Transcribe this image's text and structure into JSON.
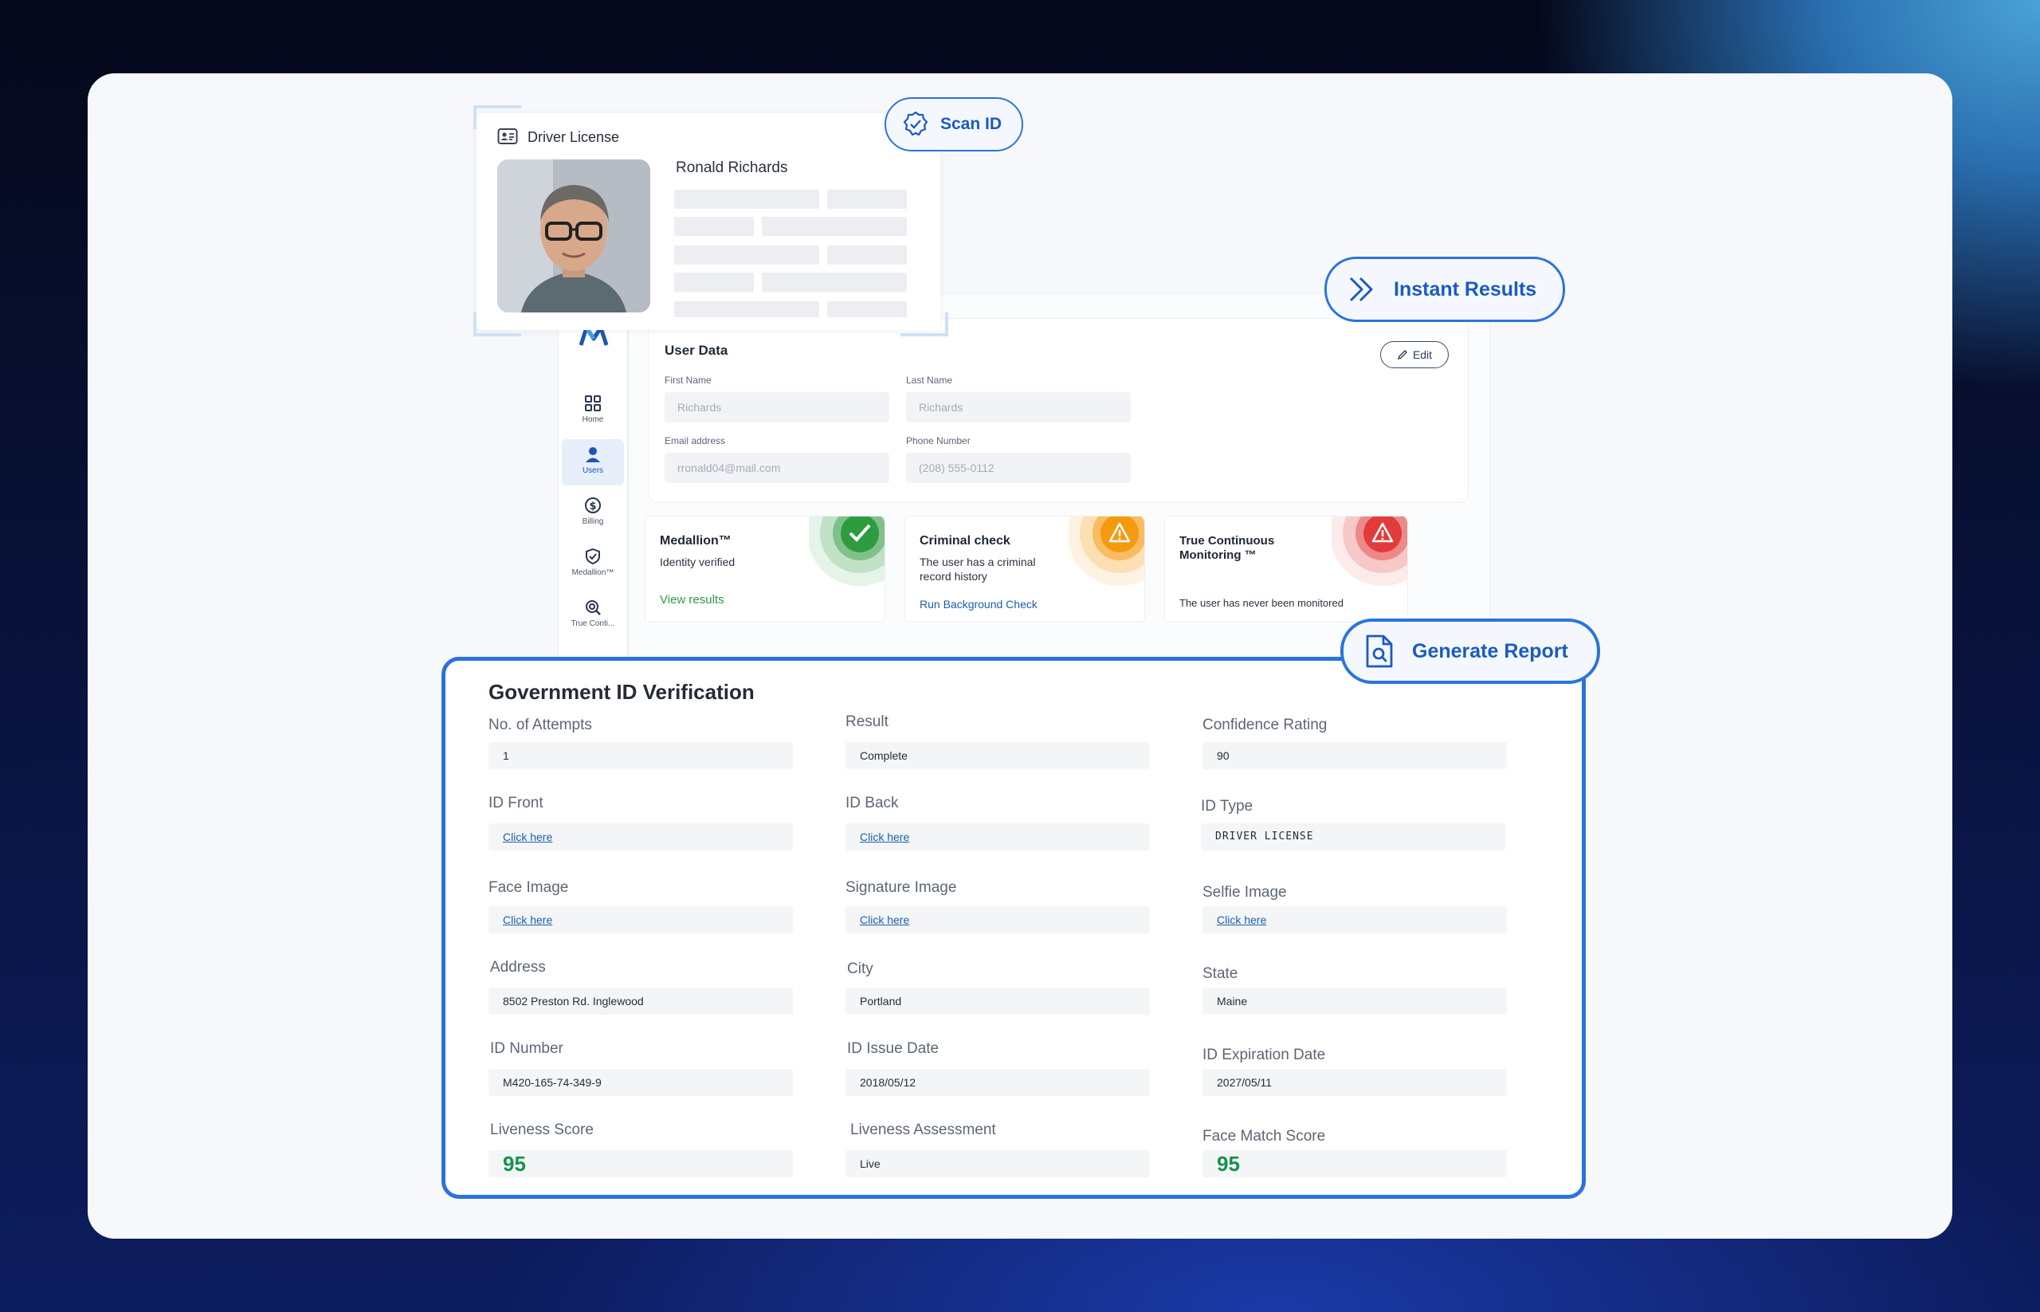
{
  "driver_license": {
    "title": "Driver License",
    "name": "Ronald Richards"
  },
  "pills": {
    "scan_id": "Scan ID",
    "instant_results": "Instant Results",
    "generate_report": "Generate Report"
  },
  "sidebar": {
    "items": [
      {
        "label": "Home",
        "icon": "grid-icon"
      },
      {
        "label": "Users",
        "icon": "user-icon"
      },
      {
        "label": "Billing",
        "icon": "dollar-icon"
      },
      {
        "label": "Medallion™",
        "icon": "shield-check-icon"
      },
      {
        "label": "True Conti...",
        "icon": "search-icon"
      }
    ]
  },
  "user_data": {
    "title": "User Data",
    "edit_label": "Edit",
    "first_name_label": "First Name",
    "first_name_value": "Richards",
    "last_name_label": "Last Name",
    "last_name_value": "Richards",
    "email_label": "Email address",
    "email_value": "rronald04@mail.com",
    "phone_label": "Phone Number",
    "phone_value": "(208) 555-0112"
  },
  "status_cards": {
    "medallion": {
      "title": "Medallion™",
      "desc": "Identity verified",
      "link": "View results",
      "color": "#2e9b3f"
    },
    "criminal": {
      "title": "Criminal check",
      "desc": "The user has a criminal record history",
      "link": "Run Background Check",
      "color": "#f59a0f"
    },
    "monitoring": {
      "title": "True Continuous Monitoring ™",
      "desc": "The user has never been monitored",
      "color": "#e23b3b"
    }
  },
  "verification": {
    "title": "Government ID Verification",
    "fields": {
      "attempts": {
        "label": "No. of Attempts",
        "value": "1"
      },
      "result": {
        "label": "Result",
        "value": "Complete"
      },
      "confidence": {
        "label": "Confidence Rating",
        "value": "90"
      },
      "id_front": {
        "label": "ID Front",
        "value": "Click here"
      },
      "id_back": {
        "label": "ID Back",
        "value": "Click here"
      },
      "id_type": {
        "label": "ID Type",
        "value": "DRIVER LICENSE"
      },
      "face_image": {
        "label": "Face Image",
        "value": "Click here"
      },
      "signature_image": {
        "label": "Signature Image",
        "value": "Click here"
      },
      "selfie_image": {
        "label": "Selfie Image",
        "value": "Click here"
      },
      "address": {
        "label": "Address",
        "value": "8502 Preston Rd. Inglewood"
      },
      "city": {
        "label": "City",
        "value": "Portland"
      },
      "state": {
        "label": "State",
        "value": "Maine"
      },
      "id_number": {
        "label": "ID Number",
        "value": "M420-165-74-349-9"
      },
      "issue_date": {
        "label": "ID Issue Date",
        "value": "2018/05/12"
      },
      "expiration_date": {
        "label": "ID Expiration Date",
        "value": "2027/05/11"
      },
      "liveness_score": {
        "label": "Liveness Score",
        "value": "95"
      },
      "liveness_assessment": {
        "label": "Liveness Assessment",
        "value": "Live"
      },
      "face_match": {
        "label": "Face Match Score",
        "value": "95"
      }
    }
  },
  "colors": {
    "accent": "#2b72de",
    "success": "#16924b",
    "link": "#1a5fb0"
  }
}
